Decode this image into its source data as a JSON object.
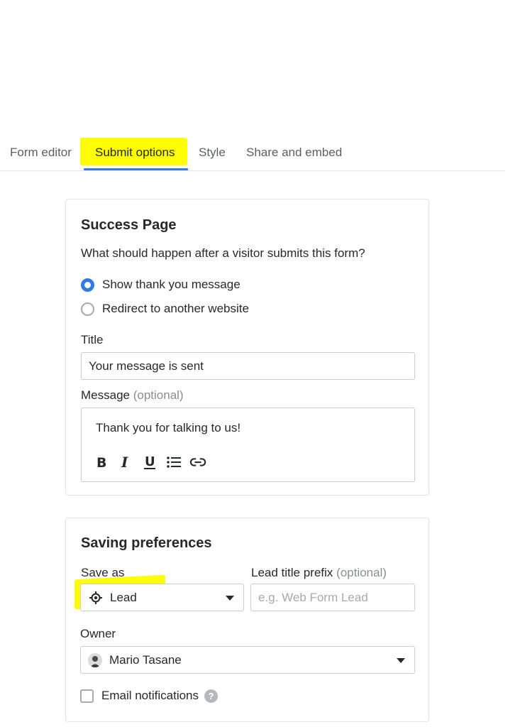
{
  "tabs": [
    {
      "label": "Form editor"
    },
    {
      "label": "Submit options"
    },
    {
      "label": "Style"
    },
    {
      "label": "Share and embed"
    }
  ],
  "success_page": {
    "title": "Success Page",
    "question": "What should happen after a visitor submits this form?",
    "options": [
      {
        "label": "Show thank you message",
        "selected": true
      },
      {
        "label": "Redirect to another website",
        "selected": false
      }
    ],
    "title_label": "Title",
    "title_value": "Your message is sent",
    "message_label": "Message",
    "message_optional": "(optional)",
    "message_value": "Thank you for talking to us!",
    "toolbar": [
      "bold-icon",
      "italic-icon",
      "underline-icon",
      "bulleted-list-icon",
      "link-icon"
    ]
  },
  "saving": {
    "title": "Saving preferences",
    "save_as_label": "Save as",
    "save_as_value": "Lead",
    "prefix_label": "Lead title prefix",
    "prefix_optional": "(optional)",
    "prefix_placeholder": "e.g. Web Form Lead",
    "owner_label": "Owner",
    "owner_value": "Mario Tasane",
    "email_notifications": "Email notifications",
    "email_checked": false
  },
  "colors": {
    "accent": "#317ae2",
    "highlight": "#ffff00"
  }
}
